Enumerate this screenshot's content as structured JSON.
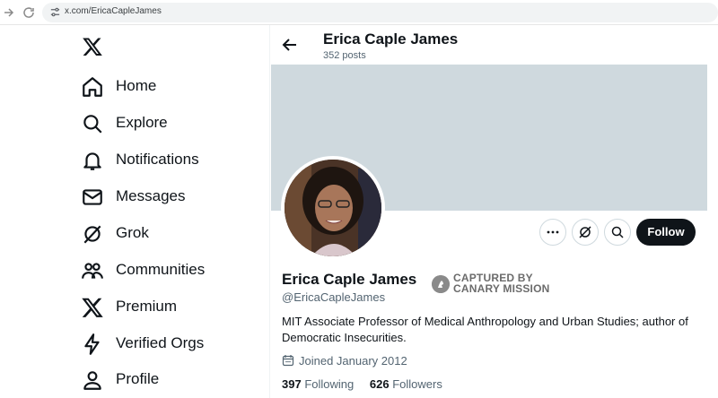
{
  "browser": {
    "url": "x.com/EricaCapleJames"
  },
  "sidebar": {
    "items": [
      {
        "label": "Home",
        "icon": "home-icon"
      },
      {
        "label": "Explore",
        "icon": "search-icon"
      },
      {
        "label": "Notifications",
        "icon": "bell-icon"
      },
      {
        "label": "Messages",
        "icon": "envelope-icon"
      },
      {
        "label": "Grok",
        "icon": "grok-icon"
      },
      {
        "label": "Communities",
        "icon": "communities-icon"
      },
      {
        "label": "Premium",
        "icon": "x-logo-icon"
      },
      {
        "label": "Verified Orgs",
        "icon": "lightning-icon"
      },
      {
        "label": "Profile",
        "icon": "person-icon"
      }
    ]
  },
  "header": {
    "name": "Erica Caple James",
    "posts": "352 posts"
  },
  "profile": {
    "name": "Erica Caple James",
    "handle": "@EricaCapleJames",
    "badge_line1": "CAPTURED BY",
    "badge_line2": "CANARY MISSION",
    "bio": "MIT Associate Professor of Medical Anthropology and Urban Studies; author of Democratic Insecurities.",
    "joined": "Joined January 2012",
    "following_count": "397",
    "following_label": "Following",
    "followers_count": "626",
    "followers_label": "Followers",
    "follow_label": "Follow"
  },
  "colors": {
    "banner": "#cfd9de",
    "follow_bg": "#0f1419",
    "muted_text": "#536471"
  }
}
